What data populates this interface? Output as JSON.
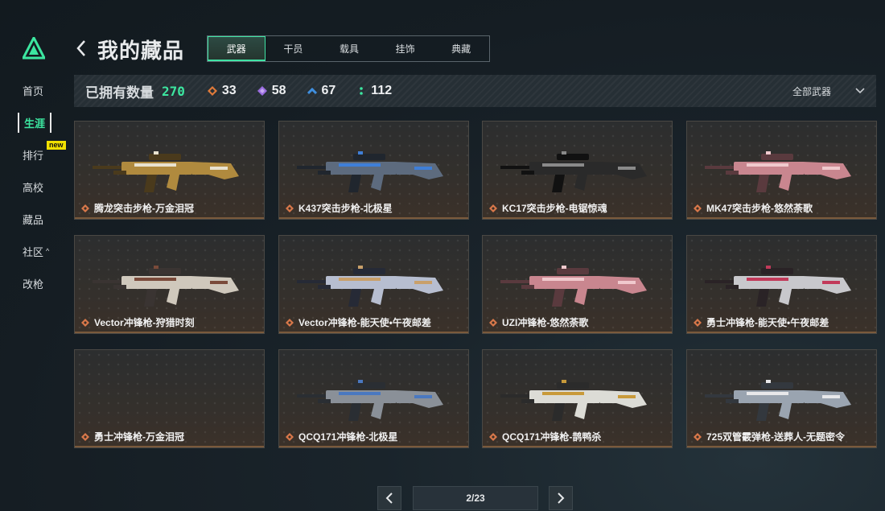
{
  "header": {
    "title": "我的藏品",
    "tabs": [
      {
        "label": "武器",
        "active": true
      },
      {
        "label": "干员",
        "active": false
      },
      {
        "label": "载具",
        "active": false
      },
      {
        "label": "挂饰",
        "active": false
      },
      {
        "label": "典藏",
        "active": false
      }
    ]
  },
  "sidebar": {
    "items": [
      {
        "label": "首页",
        "active": false
      },
      {
        "label": "生涯",
        "active": true
      },
      {
        "label": "排行",
        "active": false,
        "badge": "new"
      },
      {
        "label": "高校",
        "active": false
      },
      {
        "label": "藏品",
        "active": false
      },
      {
        "label": "社区",
        "active": false,
        "caret": "^"
      },
      {
        "label": "改枪",
        "active": false
      }
    ]
  },
  "stats": {
    "owned_label": "已拥有数量",
    "owned_total": "270",
    "tiers": [
      {
        "value": "33",
        "color": "#e07a3a",
        "icon": "orange-diamond-icon"
      },
      {
        "value": "58",
        "color": "#9a6ce0",
        "icon": "purple-diamond-icon"
      },
      {
        "value": "67",
        "color": "#3f8fe0",
        "icon": "blue-chevron-icon"
      },
      {
        "value": "112",
        "color": "#3ce6a0",
        "icon": "green-dots-icon"
      }
    ],
    "filter_label": "全部武器"
  },
  "colors": {
    "accent": "#3ce6a0",
    "rarity": "#d9784a",
    "new_badge": "#f2e100"
  },
  "items": [
    {
      "name": "腾龙突击步枪-万金泪冠",
      "style": "gold"
    },
    {
      "name": "K437突击步枪-北极星",
      "style": "blue"
    },
    {
      "name": "KC17突击步枪-电锯惊魂",
      "style": "dark"
    },
    {
      "name": "MK47突击步枪-悠然荼歌",
      "style": "pink"
    },
    {
      "name": "Vector冲锋枪-狩猎时刻",
      "style": "bone"
    },
    {
      "name": "Vector冲锋枪-能天使•午夜邮差",
      "style": "angel"
    },
    {
      "name": "UZI冲锋枪-悠然荼歌",
      "style": "pink"
    },
    {
      "name": "勇士冲锋枪-能天使•午夜邮差",
      "style": "crimson"
    },
    {
      "name": "勇士冲锋枪-万金泪冠",
      "style": "empty"
    },
    {
      "name": "QCQ171冲锋枪-北极星",
      "style": "grey"
    },
    {
      "name": "QCQ171冲锋枪-鹊鸭杀",
      "style": "white"
    },
    {
      "name": "725双管霰弹枪-送葬人-无题密令",
      "style": "steel"
    }
  ],
  "pager": {
    "indicator": "2/23"
  }
}
